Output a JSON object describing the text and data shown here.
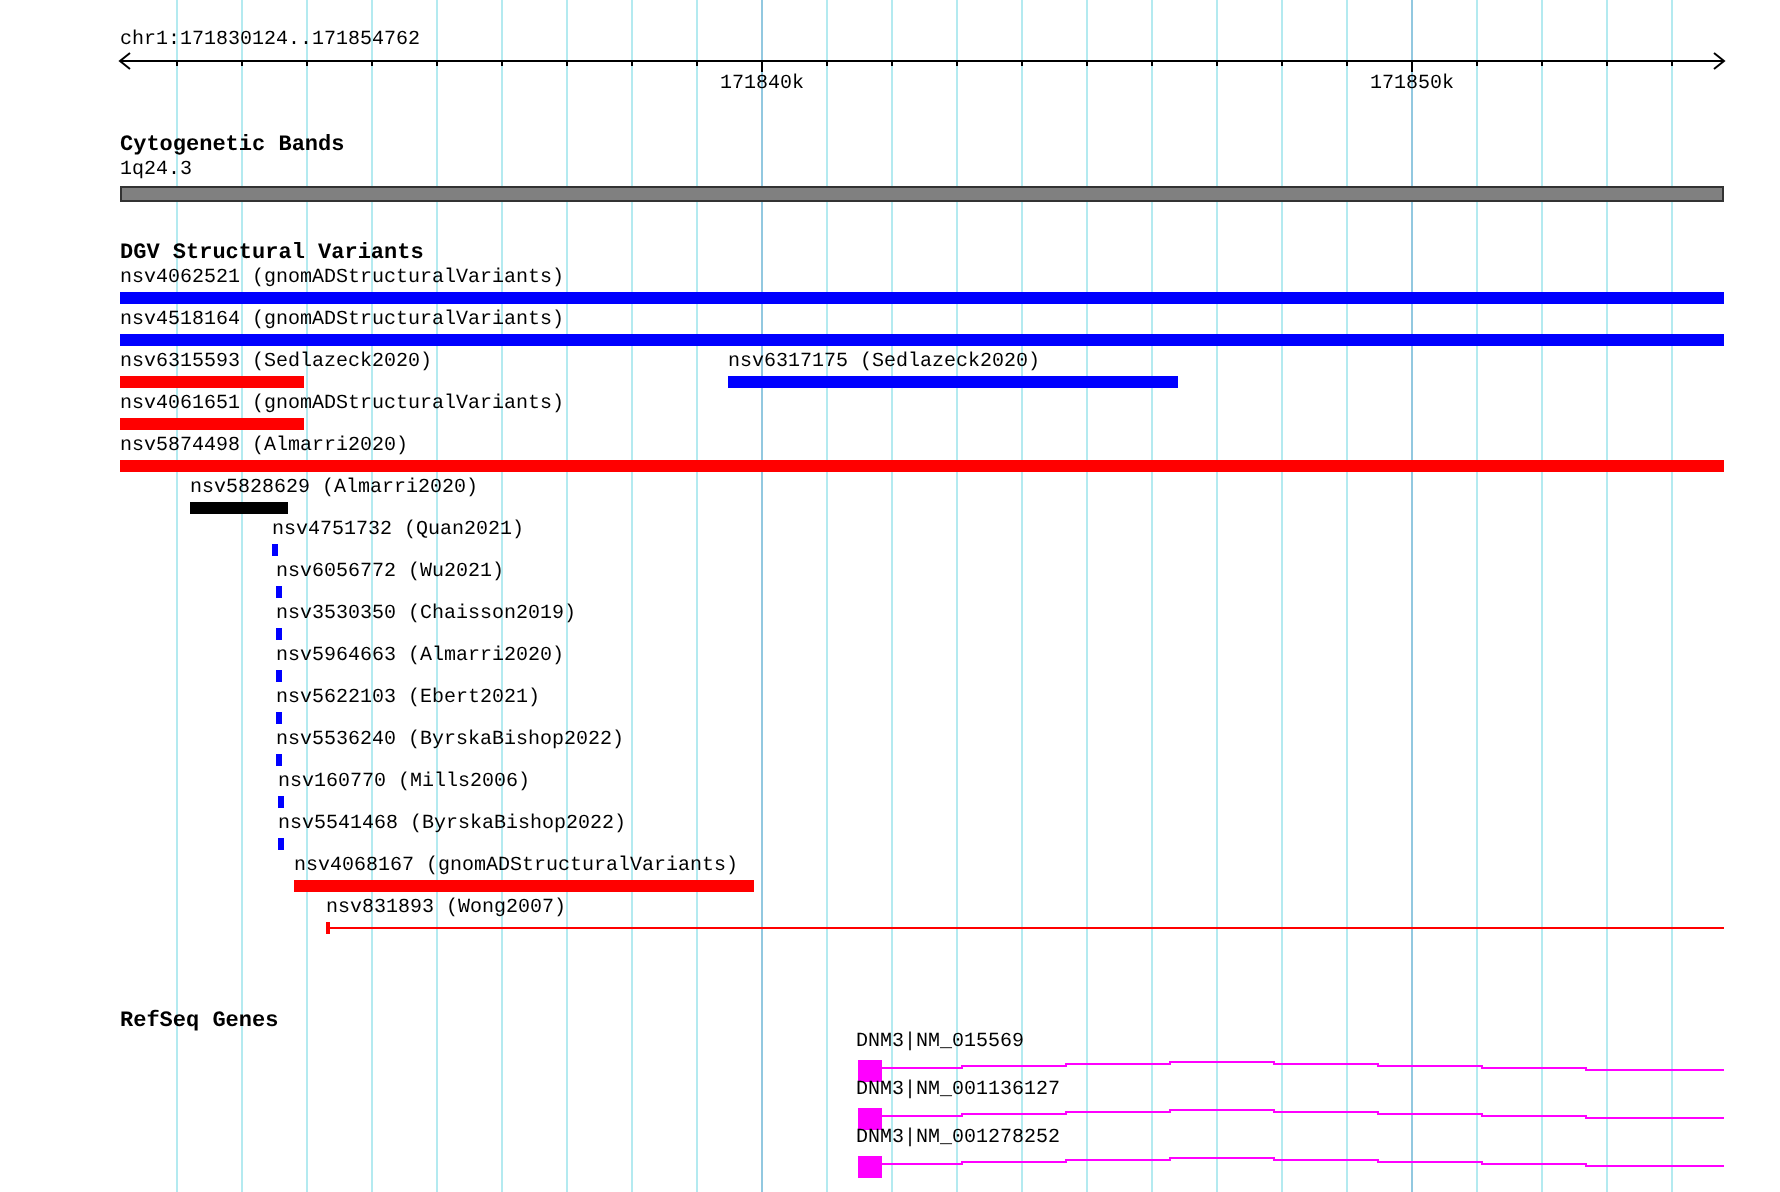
{
  "ruler": {
    "location": "chr1:171830124..171854762",
    "ticks": [
      {
        "label": "171840k"
      },
      {
        "label": "171850k"
      }
    ]
  },
  "cytogenetic_bands": {
    "title": "Cytogenetic Bands",
    "band": "1q24.3"
  },
  "dgv_structural_variants": {
    "title": "DGV Structural Variants",
    "features": [
      {
        "label": "nsv4062521 (gnomADStructuralVariants)",
        "color": "#0000ff",
        "kind": "bar"
      },
      {
        "label": "nsv4518164 (gnomADStructuralVariants)",
        "color": "#0000ff",
        "kind": "bar"
      },
      {
        "label": "nsv6315593 (Sedlazeck2020)",
        "color": "#ff0000",
        "kind": "bar"
      },
      {
        "label": "nsv6317175 (Sedlazeck2020)",
        "color": "#0000ff",
        "kind": "bar"
      },
      {
        "label": "nsv4061651 (gnomADStructuralVariants)",
        "color": "#ff0000",
        "kind": "bar"
      },
      {
        "label": "nsv5874498 (Almarri2020)",
        "color": "#ff0000",
        "kind": "bar"
      },
      {
        "label": "nsv5828629 (Almarri2020)",
        "color": "#000000",
        "kind": "bar"
      },
      {
        "label": "nsv4751732 (Quan2021)",
        "color": "#0000ff",
        "kind": "bar"
      },
      {
        "label": "nsv6056772 (Wu2021)",
        "color": "#0000ff",
        "kind": "bar"
      },
      {
        "label": "nsv3530350 (Chaisson2019)",
        "color": "#0000ff",
        "kind": "bar"
      },
      {
        "label": "nsv5964663 (Almarri2020)",
        "color": "#0000ff",
        "kind": "bar"
      },
      {
        "label": "nsv5622103 (Ebert2021)",
        "color": "#0000ff",
        "kind": "bar"
      },
      {
        "label": "nsv5536240 (ByrskaBishop2022)",
        "color": "#0000ff",
        "kind": "bar"
      },
      {
        "label": "nsv160770 (Mills2006)",
        "color": "#0000ff",
        "kind": "bar"
      },
      {
        "label": "nsv5541468 (ByrskaBishop2022)",
        "color": "#0000ff",
        "kind": "bar"
      },
      {
        "label": "nsv4068167 (gnomADStructuralVariants)",
        "color": "#ff0000",
        "kind": "bar"
      },
      {
        "label": "nsv831893 (Wong2007)",
        "color": "#ff0000",
        "kind": "line"
      }
    ]
  },
  "refseq_genes": {
    "title": "RefSeq Genes",
    "transcripts": [
      {
        "label": "DNM3|NM_015569"
      },
      {
        "label": "DNM3|NM_001136127"
      },
      {
        "label": "DNM3|NM_001278252"
      }
    ]
  }
}
